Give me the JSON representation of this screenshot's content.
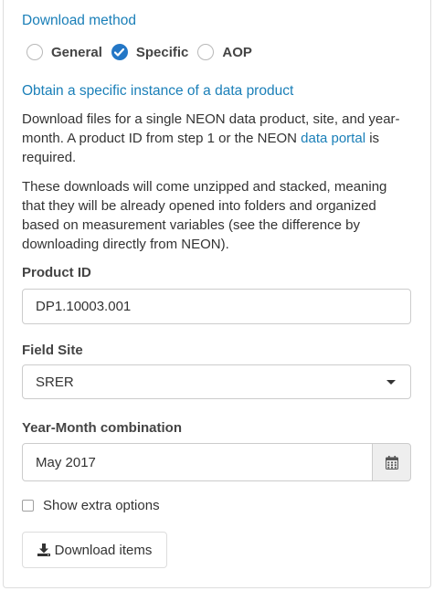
{
  "download_method": {
    "heading": "Download method",
    "options": [
      "General",
      "Specific",
      "AOP"
    ],
    "selected": "Specific"
  },
  "section": {
    "heading": "Obtain a specific instance of a data product",
    "para1_before_link": "Download files for a single NEON data product, site, and year-month. A product ID from step 1 or the NEON ",
    "para1_link": "data portal",
    "para1_after_link": " is required.",
    "para2": "These downloads will come unzipped and stacked, meaning that they will be already opened into folders and organized based on measurement variables (see the difference by downloading directly from NEON)."
  },
  "product_id": {
    "label": "Product ID",
    "value": "DP1.10003.001"
  },
  "field_site": {
    "label": "Field Site",
    "value": "SRER"
  },
  "year_month": {
    "label": "Year-Month combination",
    "value": "May 2017"
  },
  "extra_options": {
    "label": "Show extra options",
    "checked": false
  },
  "download_button": {
    "label": "Download items"
  },
  "icons": {
    "radio_checked": "check-icon",
    "calendar": "calendar-icon",
    "download": "download-icon",
    "select_caret": "caret-down-icon"
  },
  "colors": {
    "accent": "#1a7fb8",
    "radio_checked": "#2477c6"
  }
}
